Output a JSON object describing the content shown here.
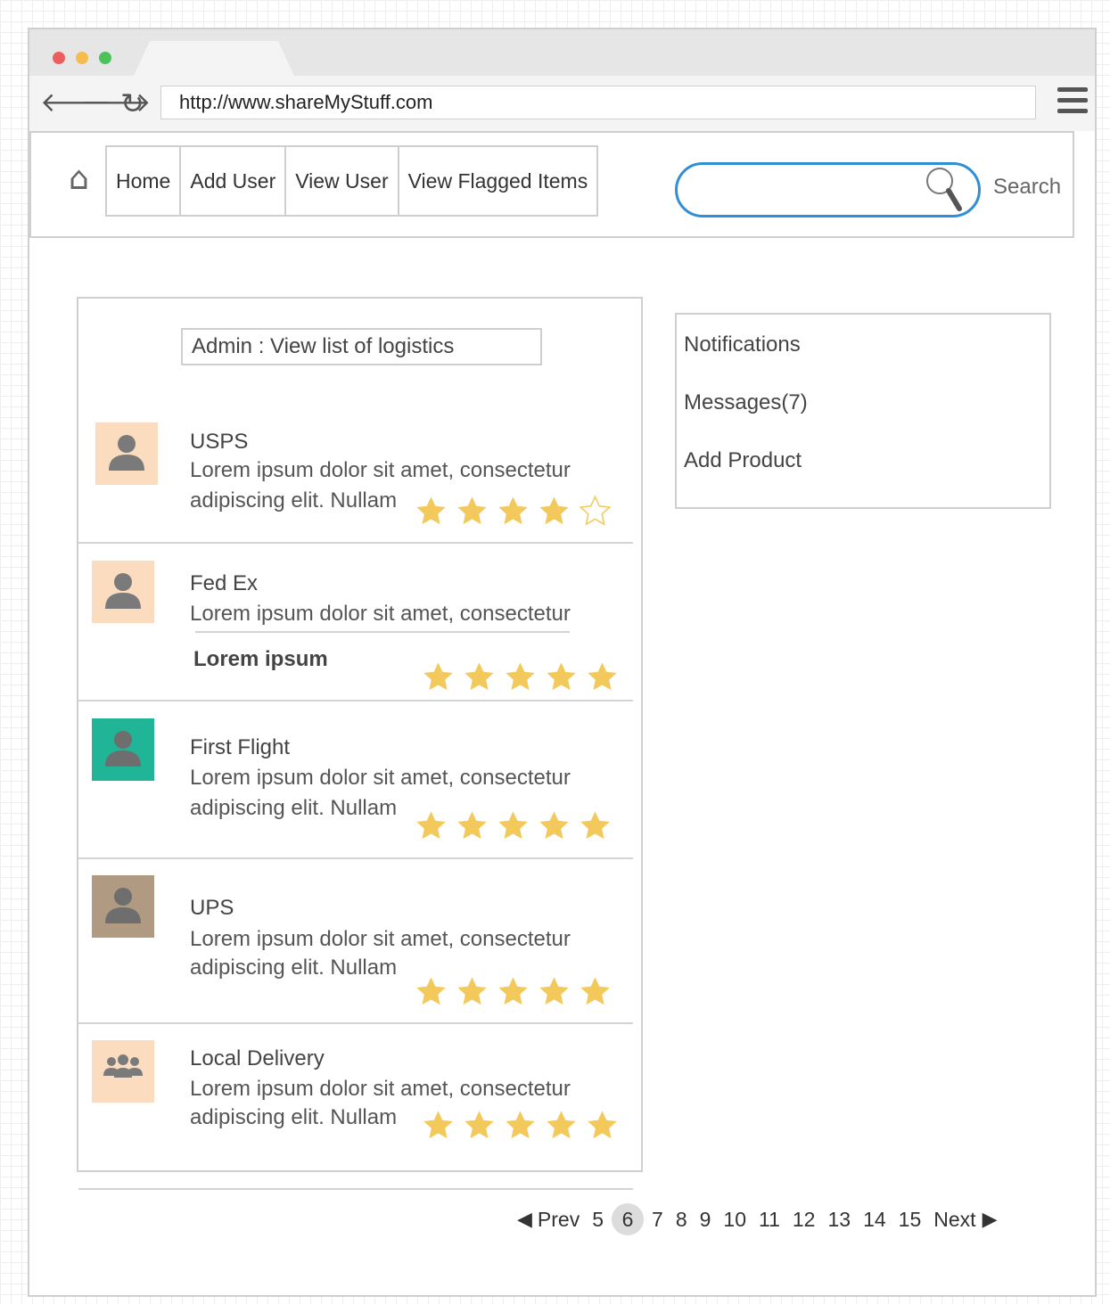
{
  "browser": {
    "url": "http://www.shareMyStuff.com",
    "window_controls": [
      "close",
      "minimize",
      "maximize"
    ],
    "nav_icons": [
      "back-arrow-icon",
      "forward-arrow-icon",
      "reload-icon",
      "hamburger-menu-icon"
    ]
  },
  "nav": {
    "home_icon": "home-icon",
    "items": [
      {
        "label": "Home"
      },
      {
        "label": "Add User"
      },
      {
        "label": "View User"
      },
      {
        "label": "View Flagged Items"
      }
    ]
  },
  "search": {
    "value": "",
    "label": "Search"
  },
  "list": {
    "title": "Admin : View list of logistics",
    "items": [
      {
        "name": "USPS",
        "desc1": "Lorem ipsum dolor sit amet, consectetur",
        "desc2": "adipiscing elit. Nullam",
        "rating": 4,
        "max_rating": 5,
        "avatar_color": "#fbdcbf",
        "avatar_type": "person"
      },
      {
        "name": "Fed Ex",
        "desc1": "Lorem ipsum dolor sit amet, consectetur",
        "subtitle": "Lorem ipsum",
        "rating": 5,
        "max_rating": 5,
        "avatar_color": "#fbdcbf",
        "avatar_type": "person"
      },
      {
        "name": "First Flight",
        "desc1": "Lorem ipsum dolor sit amet, consectetur",
        "desc2": "adipiscing elit. Nullam",
        "rating": 5,
        "max_rating": 5,
        "avatar_color": "#1fb596",
        "avatar_type": "person"
      },
      {
        "name": "UPS",
        "desc1": "Lorem ipsum dolor sit amet, consectetur",
        "desc2": "adipiscing elit. Nullam",
        "rating": 5,
        "max_rating": 5,
        "avatar_color": "#b09a82",
        "avatar_type": "person"
      },
      {
        "name": "Local Delivery",
        "desc1": "Lorem ipsum dolor sit amet, consectetur",
        "desc2": "adipiscing elit. Nullam",
        "rating": 5,
        "max_rating": 5,
        "avatar_color": "#fbdcbf",
        "avatar_type": "group"
      }
    ]
  },
  "notifications": {
    "items": [
      {
        "label": "Notifications"
      },
      {
        "label": "Messages(7)"
      },
      {
        "label": "Add Product"
      }
    ]
  },
  "pagination": {
    "prev": "Prev",
    "next": "Next",
    "pages": [
      "5",
      "6",
      "7",
      "8",
      "9",
      "10",
      "11",
      "12",
      "13",
      "14",
      "15"
    ],
    "current": "6"
  },
  "colors": {
    "star": "#f2c95a",
    "search_border": "#2f8ed6",
    "border": "#cfcfcf",
    "dot_red": "#ec5f5f",
    "dot_yellow": "#f5bd4f",
    "dot_green": "#4dc25b"
  }
}
